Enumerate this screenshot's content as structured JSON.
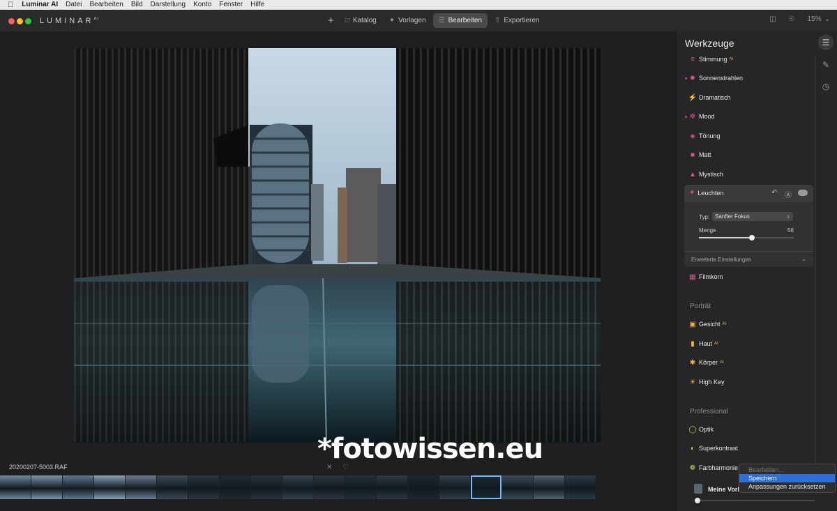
{
  "menubar": {
    "apple_icon": "apple-icon",
    "app_name": "Luminar AI",
    "items": [
      "Datei",
      "Bearbeiten",
      "Bild",
      "Darstellung",
      "Konto",
      "Fenster",
      "Hilfe"
    ]
  },
  "window": {
    "logo": "LUMINAR",
    "logo_sup": "AI",
    "traffic_colors": [
      "#fe5f57",
      "#febc2e",
      "#28c840"
    ]
  },
  "topnav": {
    "add_icon": "plus-icon",
    "tabs": [
      {
        "label": "Katalog",
        "icon": "folder-icon",
        "active": false
      },
      {
        "label": "Vorlagen",
        "icon": "templates-icon",
        "active": false
      },
      {
        "label": "Bearbeiten",
        "icon": "sliders-icon",
        "active": true
      },
      {
        "label": "Exportieren",
        "icon": "export-icon",
        "active": false
      }
    ],
    "zoom": "15%"
  },
  "image": {
    "filename": "20200207-5003.RAF",
    "watermark": "*fotowissen.eu"
  },
  "filmstrip": {
    "count": 19,
    "selected_index": 15
  },
  "panel": {
    "title": "Werkzeuge",
    "tools_top": [
      {
        "label": "Stimmung",
        "ai": "AI",
        "icon": "mood-lines-icon",
        "color": "#e0508a"
      },
      {
        "label": "Sonnenstrahlen",
        "ai": "",
        "icon": "sun-icon",
        "color": "#e0508a"
      },
      {
        "label": "Dramatisch",
        "ai": "",
        "icon": "lightning-icon",
        "color": "#e0508a"
      },
      {
        "label": "Mood",
        "ai": "",
        "icon": "mood-icon",
        "color": "#e0508a"
      },
      {
        "label": "Tönung",
        "ai": "",
        "icon": "bucket-icon",
        "color": "#e0508a"
      },
      {
        "label": "Matt",
        "ai": "",
        "icon": "square-icon",
        "color": "#e0508a"
      },
      {
        "label": "Mystisch",
        "ai": "",
        "icon": "flask-icon",
        "color": "#e0508a"
      }
    ],
    "expanded_tool": {
      "label": "Leuchten",
      "type_label": "Typ:",
      "type_value": "Sanfter Fokus",
      "amount_label": "Menge",
      "amount_value": "56",
      "amount_fraction": 0.56,
      "advanced_label": "Erweiterte Einstellungen"
    },
    "tool_after": {
      "label": "Filmkorn",
      "icon": "grain-icon"
    },
    "section_portrait": "Porträt",
    "tools_portrait": [
      {
        "label": "Gesicht",
        "ai": "AI",
        "icon": "face-icon"
      },
      {
        "label": "Haut",
        "ai": "AI",
        "icon": "skin-icon"
      },
      {
        "label": "Körper",
        "ai": "AI",
        "icon": "body-icon"
      },
      {
        "label": "High Key",
        "ai": "",
        "icon": "highkey-icon"
      }
    ],
    "section_professional": "Professional",
    "tools_professional": [
      {
        "label": "Optik",
        "icon": "optics-icon"
      },
      {
        "label": "Superkontrast",
        "icon": "contrast-icon"
      },
      {
        "label": "Farbharmonie",
        "icon": "color-harmony-icon"
      }
    ],
    "my_templates": "Meine Vorla"
  },
  "context_menu": {
    "items": [
      "Bearbeiten...",
      "Speichern",
      "Anpassungen zurücksetzen"
    ],
    "selected_index": 1
  },
  "sidebar": {
    "icons": [
      "tools-icon",
      "brush-icon",
      "history-icon"
    ]
  }
}
